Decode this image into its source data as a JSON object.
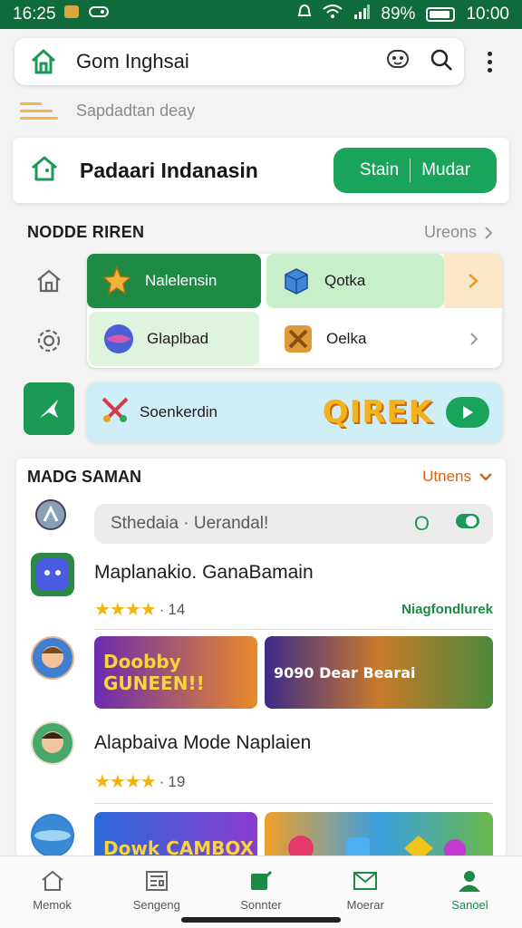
{
  "status_bar": {
    "time": "16:25",
    "battery": "89%",
    "clock": "10:00"
  },
  "app_bar": {
    "title": "Gom Inghsai"
  },
  "subtitle": "Sapdadtan deay",
  "hero": {
    "title": "Padaari Indanasin",
    "cta_left": "Stain",
    "cta_right": "Mudar"
  },
  "section1": {
    "heading": "NODDE RIREN",
    "more_label": "Ureons",
    "tiles": [
      {
        "label": "Nalelensin"
      },
      {
        "label": "Qotka"
      },
      {
        "label": "Glaplbad"
      },
      {
        "label": "Oelka"
      }
    ],
    "banner": {
      "label": "Soenkerdin",
      "word": "QIREK"
    }
  },
  "section2": {
    "heading": "MADG SAMAN",
    "more_label": "Utnens",
    "search_text": "Sthedaia · Uerandal!",
    "search_badge": "O",
    "games": [
      {
        "title": "Maplanakio. GanaBamain",
        "rating_count": "14",
        "tag": "Niagfondlurek",
        "thumb1": "Doobby GUNEEN!!",
        "thumb2": "9090 Dear Bearai"
      },
      {
        "title": "Alapbaiva Mode Naplaien",
        "rating_count": "19",
        "thumb1": "Dowk CAMBOX",
        "thumb2": ""
      }
    ]
  },
  "bottom_nav": [
    {
      "label": "Memok",
      "icon": "home-icon"
    },
    {
      "label": "Sengeng",
      "icon": "newspaper-icon"
    },
    {
      "label": "Sonnter",
      "icon": "edit-icon"
    },
    {
      "label": "Moerar",
      "icon": "mail-icon"
    },
    {
      "label": "Sanoel",
      "icon": "person-icon"
    }
  ],
  "colors": {
    "brand": "#1aa35a",
    "status_bar": "#0f6b3a",
    "accent_orange": "#d0651b",
    "star": "#f3b20f"
  }
}
